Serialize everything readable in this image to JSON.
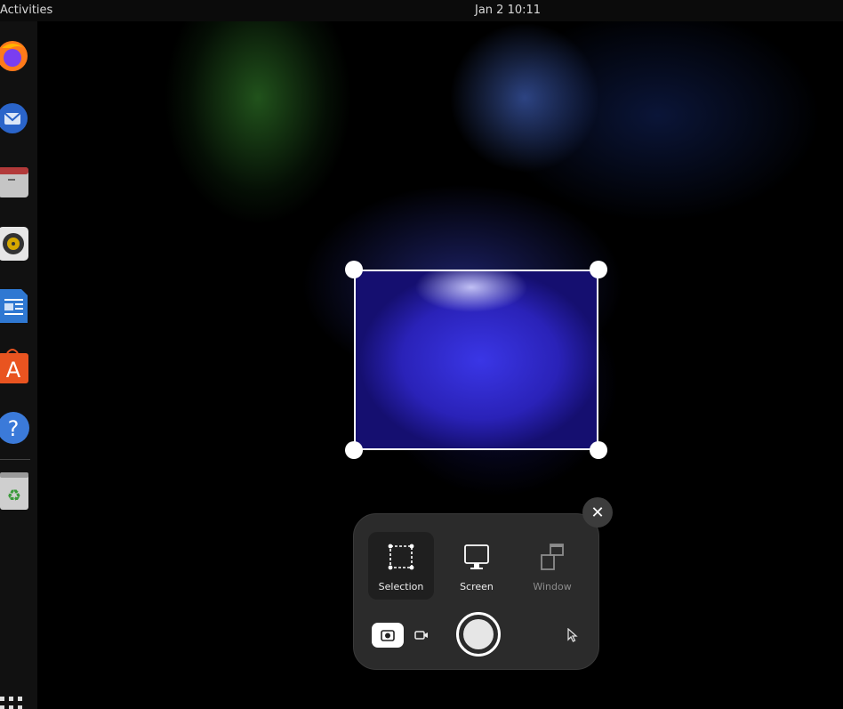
{
  "top_bar": {
    "activities_label": "Activities",
    "clock": "Jan 2  10:11"
  },
  "dock": {
    "items": [
      {
        "name": "firefox-icon"
      },
      {
        "name": "thunderbird-icon"
      },
      {
        "name": "files-icon"
      },
      {
        "name": "rhythmbox-icon"
      },
      {
        "name": "libreoffice-writer-icon"
      },
      {
        "name": "app-center-icon"
      },
      {
        "name": "help-icon",
        "glyph": "?"
      },
      {
        "name": "trash-icon",
        "glyph": "♻"
      }
    ],
    "app_center_glyph": "A"
  },
  "screenshot_ui": {
    "close_glyph": "✕",
    "modes": [
      {
        "label": "Selection",
        "icon": "selection-icon",
        "active": true
      },
      {
        "label": "Screen",
        "icon": "monitor-icon",
        "active": false
      },
      {
        "label": "Window",
        "icon": "window-icon",
        "active": false
      }
    ],
    "capture_type": "screenshot",
    "show_pointer": false
  },
  "colors": {
    "panel_bg": "#2b2b2b",
    "active_mode_bg": "#1f1f1f",
    "selection_border": "#ffffff"
  }
}
